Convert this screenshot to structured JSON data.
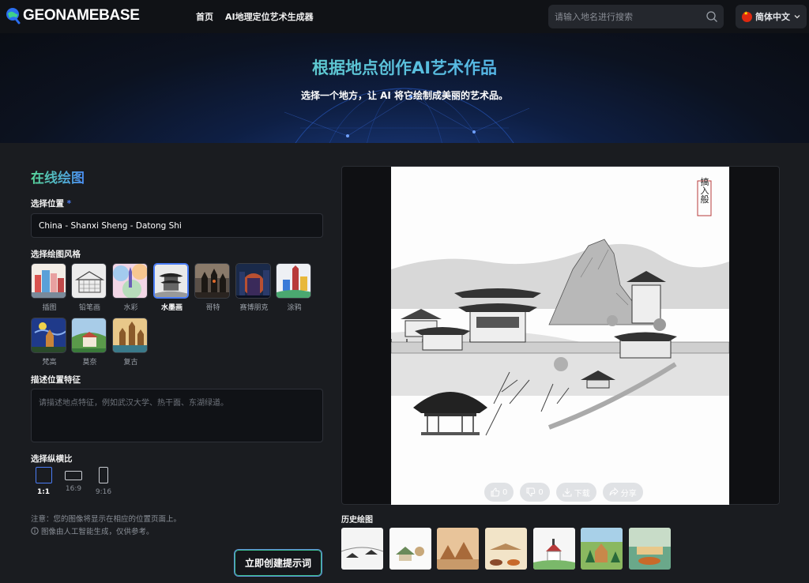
{
  "header": {
    "logo_text": "GEONAMEBASE",
    "nav": [
      "首页",
      "AI地理定位艺术生成器"
    ],
    "search_placeholder": "请输入地名进行搜索",
    "language": "简体中文"
  },
  "hero": {
    "title": "根据地点创作AI艺术作品",
    "subtitle": "选择一个地方，让 AI 将它绘制成美丽的艺术品。"
  },
  "form": {
    "section_title": "在线绘图",
    "location_label": "选择位置",
    "required_mark": "*",
    "location_value": "China - Shanxi Sheng - Datong Shi",
    "style_label": "选择绘图风格",
    "styles": [
      {
        "name": "插图",
        "selected": false
      },
      {
        "name": "铅笔画",
        "selected": false
      },
      {
        "name": "水彩",
        "selected": false
      },
      {
        "name": "水墨画",
        "selected": true
      },
      {
        "name": "哥特",
        "selected": false
      },
      {
        "name": "赛博朋克",
        "selected": false
      },
      {
        "name": "涂鸦",
        "selected": false
      },
      {
        "name": "梵高",
        "selected": false
      },
      {
        "name": "莫奈",
        "selected": false
      },
      {
        "name": "复古",
        "selected": false
      }
    ],
    "describe_label": "描述位置特征",
    "describe_placeholder": "请描述地点特征，例如武汉大学、热干面、东湖绿道。",
    "ratio_label": "选择纵横比",
    "ratios": [
      {
        "name": "1:1",
        "selected": true
      },
      {
        "name": "16:9",
        "selected": false
      },
      {
        "name": "9:16",
        "selected": false
      }
    ],
    "note_line1": "注意：您的图像将显示在相应的位置页面上。",
    "note_line2": "图像由人工智能生成，仅供参考。",
    "create_button": "立即创建提示词"
  },
  "preview": {
    "seal_text": "搞入般",
    "likes": "0",
    "dislikes": "0",
    "download": "下载",
    "share": "分享"
  },
  "history": {
    "label": "历史绘图",
    "count": 7
  },
  "colors": {
    "accent_blue": "#4a7cf5",
    "accent_green": "#58d89a",
    "background": "#1a1c20"
  }
}
